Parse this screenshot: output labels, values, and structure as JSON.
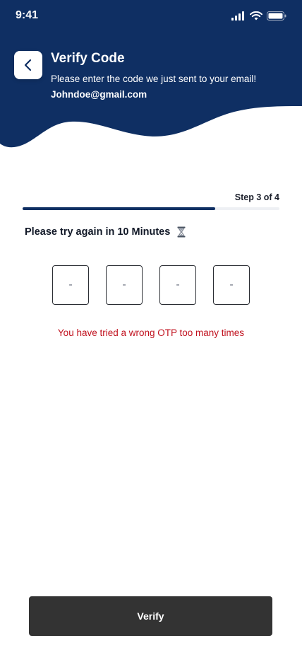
{
  "status_bar": {
    "time": "9:41"
  },
  "header": {
    "title": "Verify Code",
    "subtitle": "Please enter the code we just sent to your email!",
    "email": "Johndoe@gmail.com",
    "back_icon": "chevron-left-icon"
  },
  "progress": {
    "step_label": "Step 3 of 4",
    "fraction": 0.75
  },
  "retry": {
    "text": "Please try again in 10 Minutes",
    "icon": "hourglass-icon"
  },
  "otp": {
    "digits": [
      "-",
      "-",
      "-",
      "-"
    ]
  },
  "error": {
    "text": "You have tried a wrong OTP too many times"
  },
  "actions": {
    "verify_label": "Verify"
  },
  "colors": {
    "brand": "#0f2f63",
    "error": "#c1121f",
    "button": "#333333"
  }
}
